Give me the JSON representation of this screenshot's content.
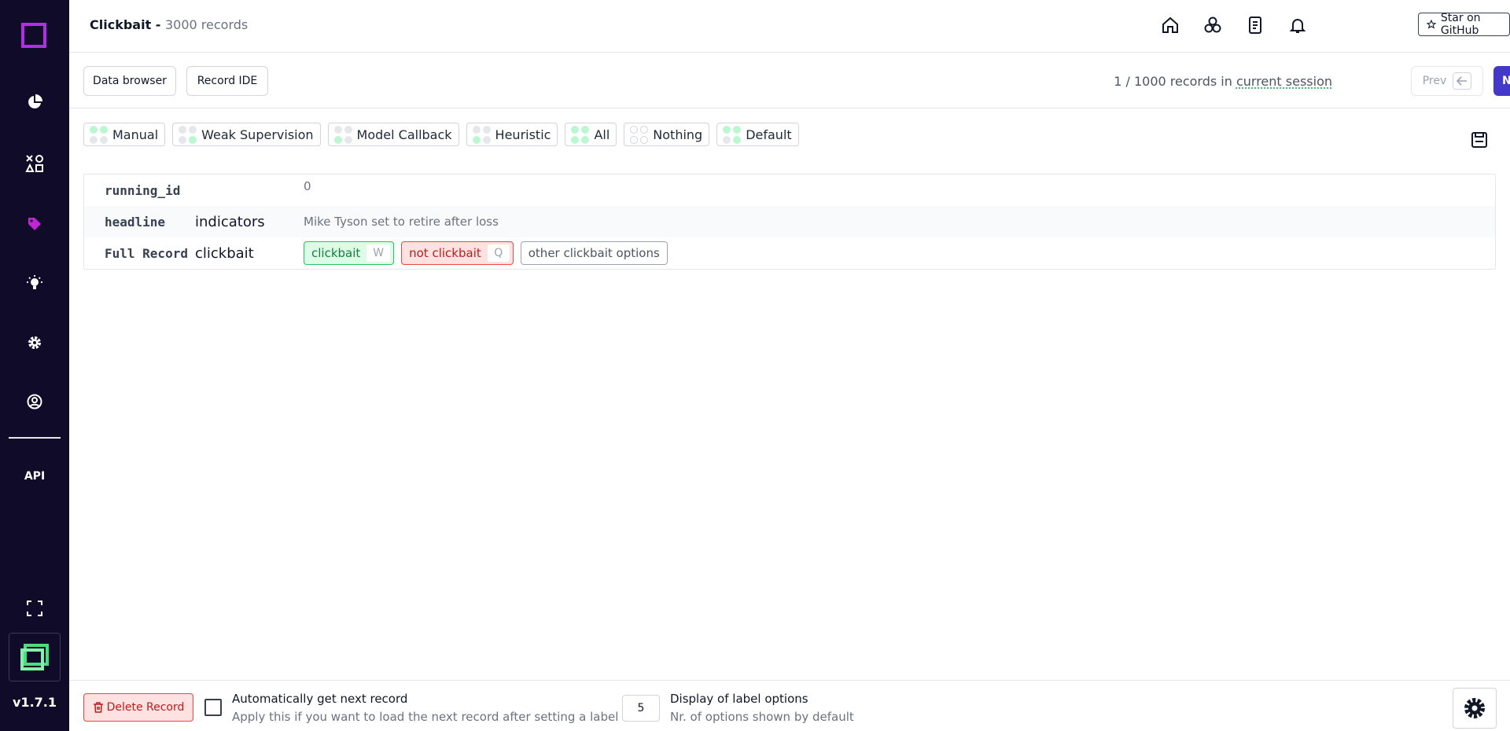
{
  "sidebar": {
    "nav": [
      {
        "icon": "pie-chart-icon"
      },
      {
        "icon": "shapes-icon"
      },
      {
        "icon": "tag-icon"
      },
      {
        "icon": "bulb-icon"
      },
      {
        "icon": "gear-icon"
      },
      {
        "icon": "user-circle-icon"
      }
    ],
    "api_label": "API",
    "version": "v1.7.1"
  },
  "header": {
    "project_name": "Clickbait - ",
    "record_count": "3000 records",
    "github_label": "Star on GitHub"
  },
  "toolbar": {
    "data_browser": "Data browser",
    "record_ide": "Record IDE",
    "session_prefix": "1 / 1000 records in ",
    "session_link": "current session",
    "prev": "Prev",
    "next": "Next"
  },
  "filters": [
    {
      "label": "Manual",
      "dots": [
        "#bbf7d0",
        "#bbf7d0",
        "#e5e7eb",
        "#e5e7eb"
      ]
    },
    {
      "label": "Weak Supervision",
      "dots": [
        "#e5e7eb",
        "#e5e7eb",
        "#e5e7eb",
        "#bbf7d0"
      ]
    },
    {
      "label": "Model Callback",
      "dots": [
        "#e5e7eb",
        "#e5e7eb",
        "#bbf7d0",
        "#e5e7eb"
      ]
    },
    {
      "label": "Heuristic",
      "dots": [
        "#e5e7eb",
        "#e5e7eb",
        "#bbf7d0",
        "#e5e7eb"
      ]
    },
    {
      "label": "All",
      "dots": [
        "#bbf7d0",
        "#bbf7d0",
        "#bbf7d0",
        "#bbf7d0"
      ]
    },
    {
      "label": "Nothing",
      "dots": [
        "#ffffff",
        "#ffffff",
        "#ffffff",
        "#ffffff"
      ]
    },
    {
      "label": "Default",
      "dots": [
        "#bbf7d0",
        "#bbf7d0",
        "#e5e7eb",
        "#bbf7d0"
      ]
    }
  ],
  "record": {
    "rows": [
      {
        "attribute": "running_id",
        "task": "",
        "value": "0"
      },
      {
        "attribute": "headline",
        "task": "indicators",
        "value": "Mike Tyson set to retire after loss"
      },
      {
        "attribute": "Full Record",
        "task": "clickbait",
        "value": ""
      }
    ],
    "labels": [
      {
        "name": "clickbait",
        "key": "W"
      },
      {
        "name": "not clickbait",
        "key": "Q"
      }
    ],
    "other_options": "other clickbait options"
  },
  "footer": {
    "delete": "Delete Record",
    "auto_title": "Automatically get next record",
    "auto_sub": "Apply this if you want to load the next record after setting a label",
    "display_count": "5",
    "display_title": "Display of label options",
    "display_sub": "Nr. of options shown by default"
  },
  "colors": {
    "sidebar_bg": "#0f0b29",
    "accent": "#4338ca",
    "logo_purple": "#b12ee6",
    "brand_green": "#4ade80"
  }
}
